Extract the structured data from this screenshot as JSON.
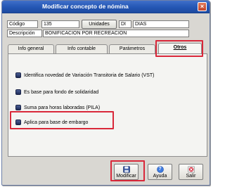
{
  "window": {
    "title": "Modificar concepto de nómina",
    "close_glyph": "×"
  },
  "form": {
    "codigo_label": "Código",
    "codigo_value": "135",
    "unidades_button": "Unidades",
    "unidad_code": "DI",
    "unidad_name": "DIAS",
    "descripcion_label": "Descripción",
    "descripcion_value": "BONIFICACION POR RECREACION"
  },
  "tabs": [
    {
      "label": "Info general",
      "active": false
    },
    {
      "label": "Info contable",
      "active": false
    },
    {
      "label": "Parámetros",
      "active": false
    },
    {
      "label": "Otros",
      "active": true
    }
  ],
  "options": [
    {
      "label": "Identifica novedad de Variación Transitoria de Salario (VST)",
      "checked": true
    },
    {
      "label": "Es base para fondo de solidaridad",
      "checked": true
    },
    {
      "label": "Suma para horas laboradas (PILA)",
      "checked": true
    },
    {
      "label": "Aplica para base de embargo",
      "checked": true,
      "highlighted": true
    }
  ],
  "footer": {
    "modificar_label": "Modificar",
    "ayuda_label": "Ayuda",
    "salir_label": "Salir",
    "ayuda_icon_glyph": "?"
  },
  "colors": {
    "title_bar": "#2456b4",
    "annotation_red": "#d9283a",
    "checkbox_navy": "#1e2c57"
  },
  "icons": {
    "modificar": "floppy-disk-icon",
    "ayuda": "help-icon",
    "salir": "exit-icon"
  }
}
